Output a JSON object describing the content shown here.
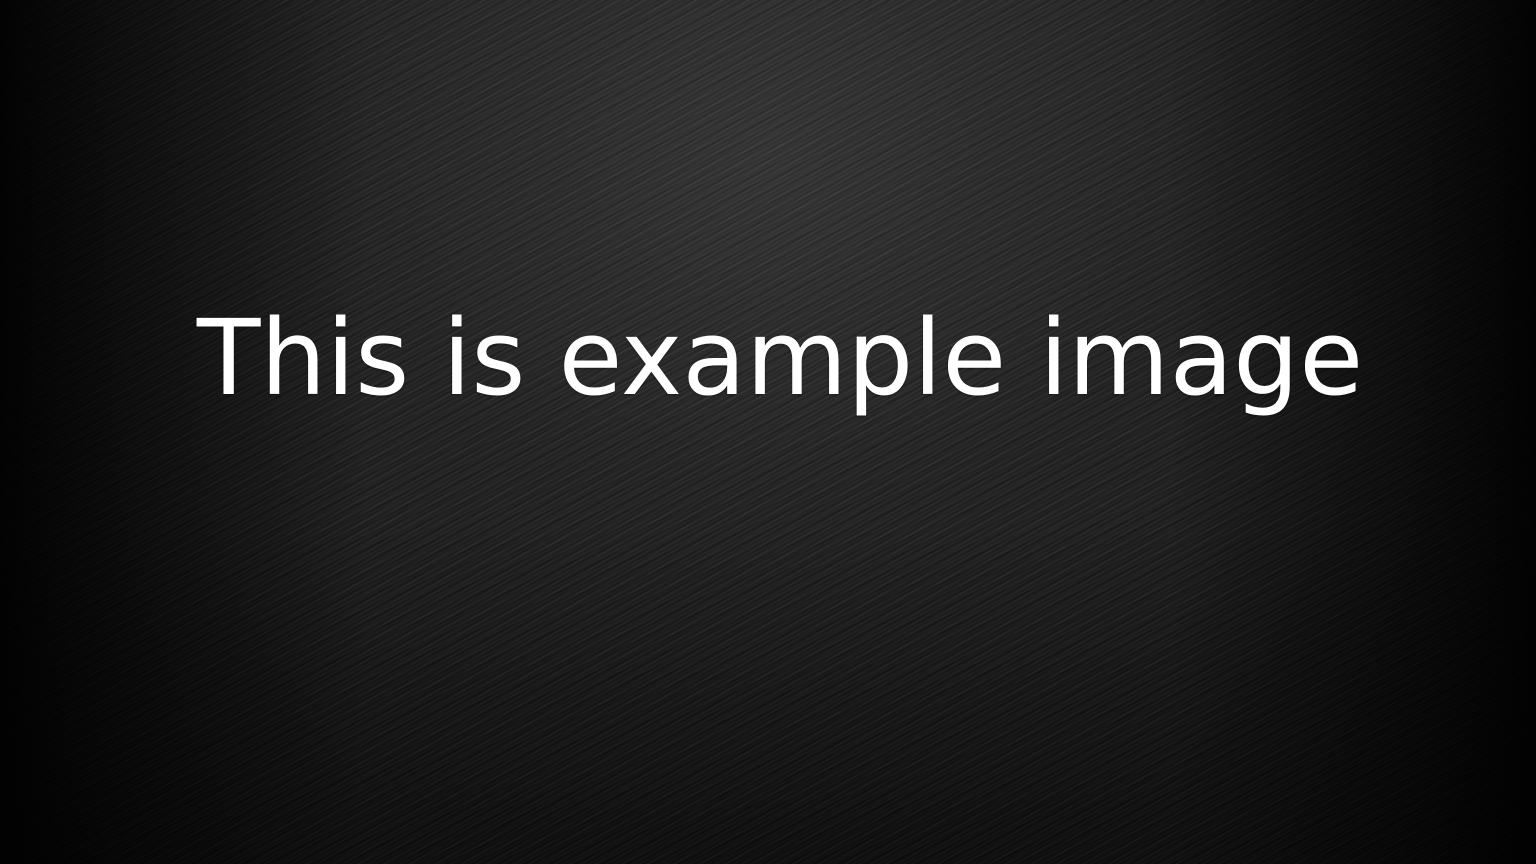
{
  "slide": {
    "headline": "This is example image"
  },
  "colors": {
    "background": "#1a1a1a",
    "vignette": "#000000",
    "text": "#ffffff"
  }
}
